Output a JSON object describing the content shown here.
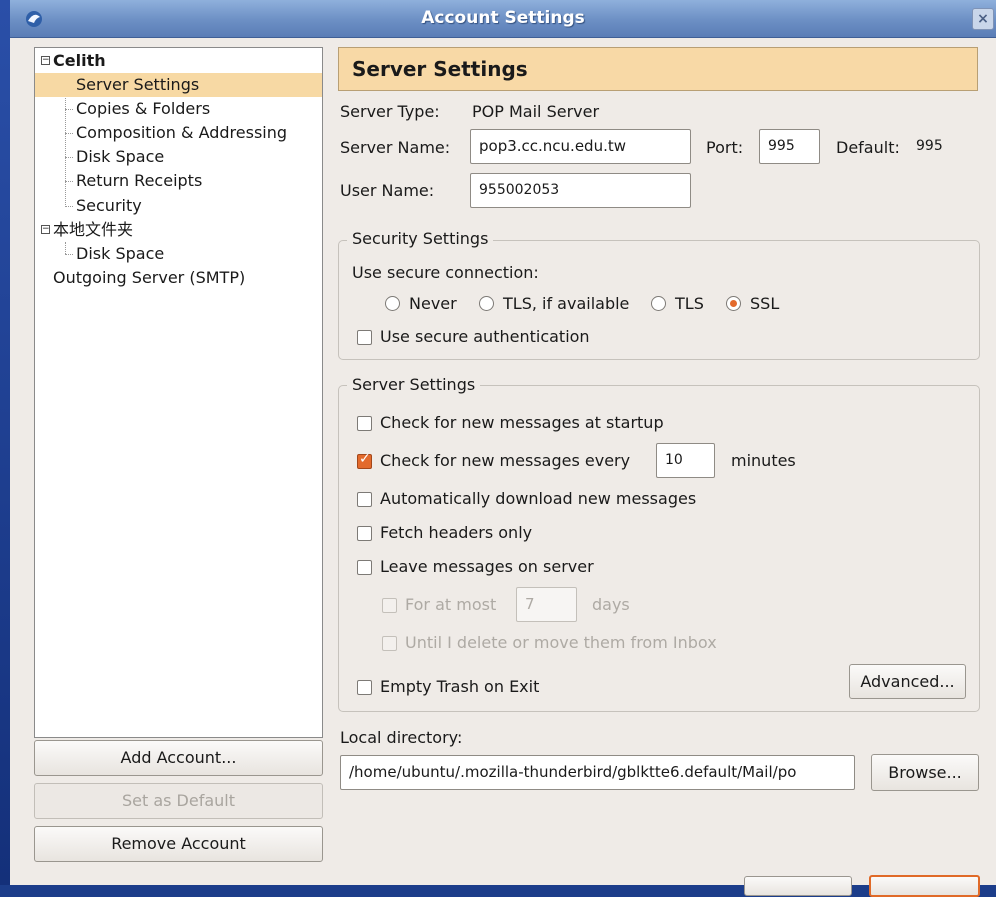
{
  "window": {
    "title": "Account Settings",
    "close_label": "×"
  },
  "sidebar": {
    "account_name": "Celith",
    "account_items": [
      "Server Settings",
      "Copies & Folders",
      "Composition & Addressing",
      "Disk Space",
      "Return Receipts",
      "Security"
    ],
    "local_folders_name": "本地文件夹",
    "local_items": [
      "Disk Space"
    ],
    "outgoing_server": "Outgoing Server (SMTP)",
    "expander_symbol": "−"
  },
  "buttons": {
    "add_account": "Add Account...",
    "set_default": "Set as Default",
    "remove_account": "Remove Account",
    "advanced": "Advanced...",
    "browse": "Browse..."
  },
  "panel": {
    "title": "Server Settings",
    "server_type_label": "Server Type:",
    "server_type_value": "POP Mail Server",
    "server_name_label": "Server Name:",
    "server_name_value": "pop3.cc.ncu.edu.tw",
    "port_label": "Port:",
    "port_value": "995",
    "default_label": "Default:",
    "default_value": "995",
    "user_name_label": "User Name:",
    "user_name_value": "955002053"
  },
  "security": {
    "frame_title": "Security Settings",
    "use_secure_label": "Use secure connection:",
    "options": [
      "Never",
      "TLS, if available",
      "TLS",
      "SSL"
    ],
    "selected": "SSL",
    "secure_auth_label": "Use secure authentication",
    "secure_auth_checked": false
  },
  "server_settings": {
    "frame_title": "Server Settings",
    "check_startup": "Check for new messages at startup",
    "check_every": "Check for new messages every",
    "check_every_value": "10",
    "minutes": "minutes",
    "auto_download": "Automatically download new messages",
    "fetch_headers": "Fetch headers only",
    "leave_on_server": "Leave messages on server",
    "for_at_most": "For at most",
    "for_at_most_value": "7",
    "days": "days",
    "until_delete": "Until I delete or move them from Inbox",
    "empty_trash": "Empty Trash on Exit"
  },
  "local_directory": {
    "label": "Local directory:",
    "value": "/home/ubuntu/.mozilla-thunderbird/gblktte6.default/Mail/po"
  }
}
